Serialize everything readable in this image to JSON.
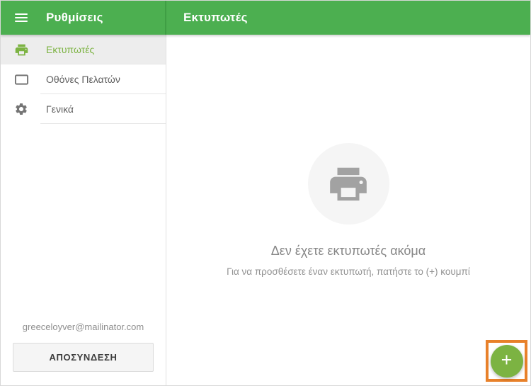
{
  "header": {
    "sidebar_title": "Ρυθμίσεις",
    "main_title": "Εκτυπωτές"
  },
  "sidebar": {
    "items": [
      {
        "label": "Εκτυπωτές",
        "icon": "printer-icon",
        "selected": true
      },
      {
        "label": "Οθόνες Πελατών",
        "icon": "display-icon",
        "selected": false
      },
      {
        "label": "Γενικά",
        "icon": "gear-icon",
        "selected": false
      }
    ],
    "account_email": "greeceloyver@mailinator.com",
    "logout_label": "ΑΠΟΣΥΝΔΕΣΗ"
  },
  "main": {
    "empty_state": {
      "icon": "printer-icon",
      "title": "Δεν έχετε εκτυπωτές ακόμα",
      "subtitle": "Για να προσθέσετε έναν εκτυπωτή, πατήστε το (+) κουμπί"
    },
    "fab": {
      "label": "+"
    }
  },
  "colors": {
    "header_green": "#4caf50",
    "accent_green": "#7cb342",
    "annotation_orange": "#e8812a",
    "selected_item_bg": "#ededed"
  }
}
